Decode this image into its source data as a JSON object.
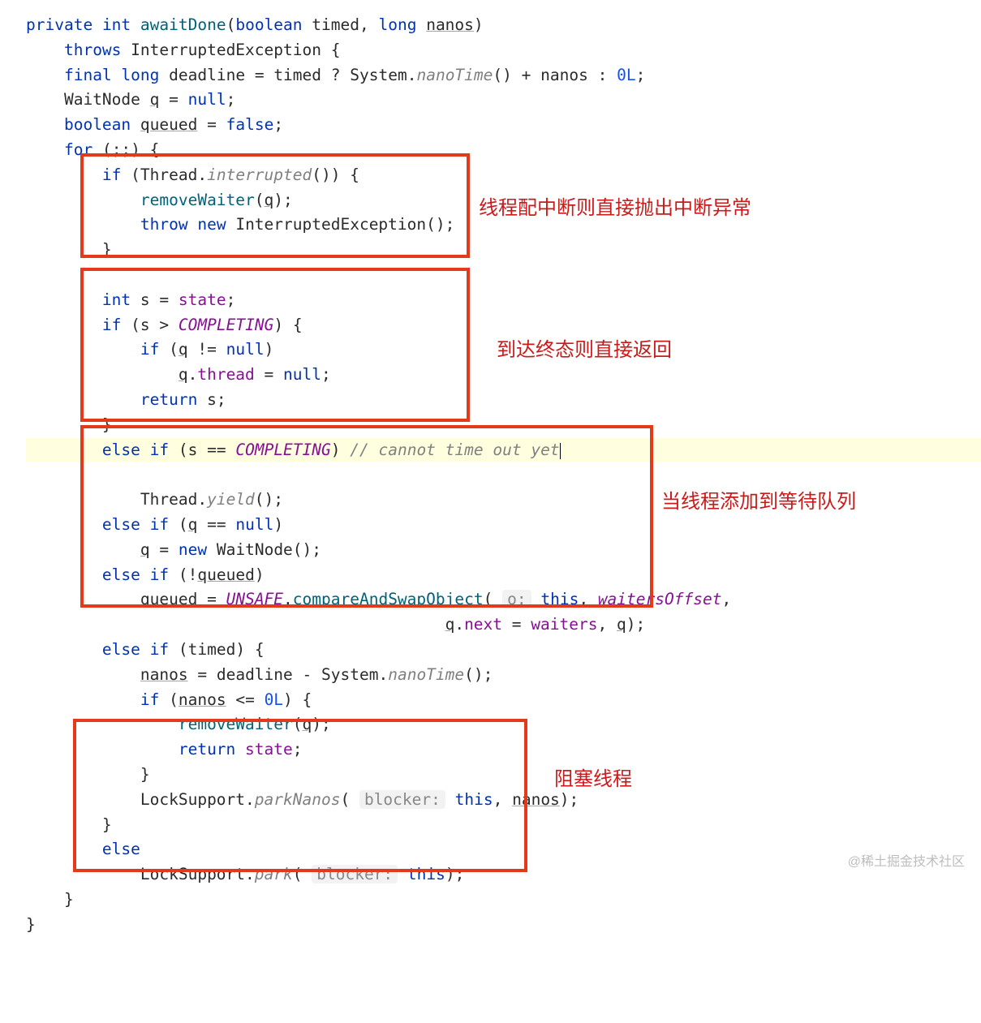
{
  "code": {
    "l1_private": "private",
    "l1_int": "int",
    "l1_method": "awaitDone",
    "l1_paren_open": "(",
    "l1_boolean": "boolean",
    "l1_timed": "timed",
    "l1_comma": ",",
    "l1_long": "long",
    "l1_nanos": "nanos",
    "l1_paren_close": ")",
    "l2_throws": "throws",
    "l2_exc": "InterruptedException",
    "l2_brace": "{",
    "l3_final": "final",
    "l3_long": "long",
    "l3_var": "deadline",
    "l3_eq": "=",
    "l3_timed": "timed",
    "l3_q": "?",
    "l3_system": "System",
    "l3_dot": ".",
    "l3_nano": "nanoTime",
    "l3_call": "()",
    "l3_plus": "+",
    "l3_nanos": "nanos",
    "l3_colon": ":",
    "l3_zero": "0L",
    "l3_semi": ";",
    "l4_type": "WaitNode",
    "l4_q": "q",
    "l4_eq": "=",
    "l4_null": "null",
    "l4_semi": ";",
    "l5_boolean": "boolean",
    "l5_queued": "queued",
    "l5_eq": "=",
    "l5_false": "false",
    "l5_semi": ";",
    "l6_for": "for",
    "l6_paren": "(;;)",
    "l6_brace": "{",
    "l7_if": "if",
    "l7_paren_open": "(",
    "l7_thread": "Thread",
    "l7_dot": ".",
    "l7_interrupted": "interrupted",
    "l7_call": "())",
    "l7_brace": "{",
    "l8_call": "removeWaiter",
    "l8_open": "(",
    "l8_q": "q",
    "l8_close": ");",
    "l9_throw": "throw",
    "l9_new": "new",
    "l9_exc": "InterruptedException",
    "l9_call": "();",
    "l10_brace": "}",
    "l12_int": "int",
    "l12_s": "s",
    "l12_eq": "=",
    "l12_state": "state",
    "l12_semi": ";",
    "l13_if": "if",
    "l13_open": "(",
    "l13_s": "s",
    "l13_gt": ">",
    "l13_comp": "COMPLETING",
    "l13_close": ")",
    "l13_brace": "{",
    "l14_if": "if",
    "l14_open": "(",
    "l14_q": "q",
    "l14_neq": "!=",
    "l14_null": "null",
    "l14_close": ")",
    "l15_q": "q",
    "l15_dot": ".",
    "l15_thread": "thread",
    "l15_eq": "=",
    "l15_null": "null",
    "l15_semi": ";",
    "l16_return": "return",
    "l16_s": "s",
    "l16_semi": ";",
    "l17_brace": "}",
    "l18_else": "else",
    "l18_if": "if",
    "l18_open": "(",
    "l18_s": "s",
    "l18_eqeq": "==",
    "l18_comp": "COMPLETING",
    "l18_close": ")",
    "l18_cmt": "// cannot time out yet",
    "l19_thread": "Thread",
    "l19_dot": ".",
    "l19_yield": "yield",
    "l19_call": "();",
    "l20_else": "else",
    "l20_if": "if",
    "l20_open": "(",
    "l20_q": "q",
    "l20_eqeq": "==",
    "l20_null": "null",
    "l20_close": ")",
    "l21_q": "q",
    "l21_eq": "=",
    "l21_new": "new",
    "l21_type": "WaitNode",
    "l21_call": "();",
    "l22_else": "else",
    "l22_if": "if",
    "l22_open": "(",
    "l22_not": "!",
    "l22_queued": "queued",
    "l22_close": ")",
    "l23_queued": "queued",
    "l23_eq": "=",
    "l23_unsafe": "UNSAFE",
    "l23_dot": ".",
    "l23_cas": "compareAndSwapObject",
    "l23_open": "(",
    "l23_hint": "o:",
    "l23_this": "this",
    "l23_comma": ",",
    "l23_woff": "waitersOffset",
    "l23_comma2": ",",
    "l24_q": "q",
    "l24_dot": ".",
    "l24_next": "next",
    "l24_eq": "=",
    "l24_waiters": "waiters",
    "l24_comma": ",",
    "l24_q2": "q",
    "l24_close": ");",
    "l25_else": "else",
    "l25_if": "if",
    "l25_open": "(",
    "l25_timed": "timed",
    "l25_close": ")",
    "l25_brace": "{",
    "l26_nanos": "nanos",
    "l26_eq": "=",
    "l26_deadline": "deadline",
    "l26_minus": "-",
    "l26_system": "System",
    "l26_dot": ".",
    "l26_nano": "nanoTime",
    "l26_call": "();",
    "l27_if": "if",
    "l27_open": "(",
    "l27_nanos": "nanos",
    "l27_le": "<=",
    "l27_zero": "0L",
    "l27_close": ")",
    "l27_brace": "{",
    "l28_call": "removeWaiter",
    "l28_open": "(",
    "l28_q": "q",
    "l28_close": ");",
    "l29_return": "return",
    "l29_state": "state",
    "l29_semi": ";",
    "l30_brace": "}",
    "l31_ls": "LockSupport",
    "l31_dot": ".",
    "l31_parknanos": "parkNanos",
    "l31_open": "(",
    "l31_hint": "blocker:",
    "l31_this": "this",
    "l31_comma": ",",
    "l31_nanos": "nanos",
    "l31_close": ");",
    "l32_brace": "}",
    "l33_else": "else",
    "l34_ls": "LockSupport",
    "l34_dot": ".",
    "l34_park": "park",
    "l34_open": "(",
    "l34_hint": "blocker:",
    "l34_this": "this",
    "l34_close": ");",
    "l35_brace": "}",
    "l36_brace": "}"
  },
  "annot": {
    "a1": "线程配中断则直接抛出中断异常",
    "a2": "到达终态则直接返回",
    "a3": "当线程添加到等待队列",
    "a4": "阻塞线程"
  },
  "watermark": "@稀土掘金技术社区"
}
